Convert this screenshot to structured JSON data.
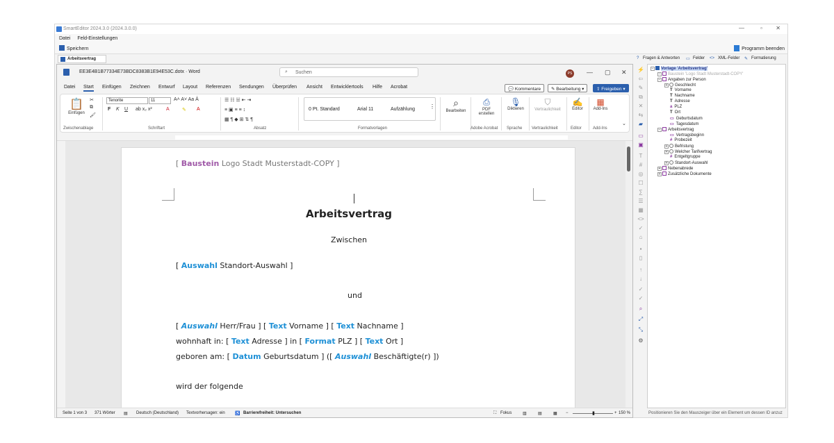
{
  "app": {
    "title": "SmartEditor 2024.3.0 (2024.3.0.0)",
    "menu": [
      "Datei",
      "Feld-Einstellungen"
    ],
    "save": "Speichern",
    "quit": "Programm beenden",
    "doc_tab": "Arbeitsvertrag"
  },
  "word": {
    "filename": "EE3E4B1B77334E73BDC8383B1E94E53C.dotx · Word",
    "search": "Suchen",
    "user_initials": "PS",
    "tabs": [
      "Datei",
      "Start",
      "Einfügen",
      "Zeichnen",
      "Entwurf",
      "Layout",
      "Referenzen",
      "Sendungen",
      "Überprüfen",
      "Ansicht",
      "Entwicklertools",
      "Hilfe",
      "Acrobat"
    ],
    "kommentare": "Kommentare",
    "bearbeitung": "Bearbeitung",
    "freigeben": "Freigeben",
    "ribbon": {
      "einfuegen": "Einfügen",
      "font": "Tenorite",
      "size": "11",
      "styles": [
        "0 Pt. Standard",
        "Arial 11",
        "Aufzählung"
      ],
      "bearbeiten": "Bearbeiten",
      "pdf": "PDF erstellen",
      "diktieren": "Diktieren",
      "vertraulichkeit": "Vertraulichkeit",
      "editor": "Editor",
      "addins": "Add-Ins",
      "groups": [
        "Zwischenablage",
        "Schriftart",
        "Absatz",
        "Formatvorlagen",
        "Adobe Acrobat",
        "Sprache",
        "Vertraulichkeit",
        "Editor",
        "Add-Ins"
      ]
    },
    "doc": {
      "l1_tag": "Baustein",
      "l1_text": "Logo Stadt Musterstadt-COPY",
      "heading": "Arbeitsvertrag",
      "zwischen": "Zwischen",
      "l2_tag": "Auswahl",
      "l2_text": "Standort-Auswahl",
      "und": "und",
      "l3a_tag": "Auswahl",
      "l3a_text": "Herr/Frau",
      "l3b_tag": "Text",
      "l3b_text": "Vorname",
      "l3c_tag": "Text",
      "l3c_text": "Nachname",
      "l4_pre": "wohnhaft in:",
      "l4a_tag": "Text",
      "l4a_text": "Adresse",
      "l4_in": "in",
      "l4b_tag": "Format",
      "l4b_text": "PLZ",
      "l4c_tag": "Text",
      "l4c_text": "Ort",
      "l5_pre": "geboren am:",
      "l5a_tag": "Datum",
      "l5a_text": "Geburtsdatum",
      "l5b_tag": "Auswahl",
      "l5b_text": "Beschäftigte(r)",
      "l6": "wird der folgende"
    },
    "status": {
      "page": "Seite 1 von 3",
      "words": "371 Wörter",
      "lang": "Deutsch (Deutschland)",
      "predict": "Textvorhersagen: ein",
      "access": "Barrierefreiheit: Untersuchen",
      "focus": "Fokus",
      "zoom": "150 %"
    }
  },
  "side": {
    "tabs": [
      "Fragen & Antworten",
      "Felder",
      "XML-Felder",
      "Formatierung"
    ],
    "tree": [
      {
        "label": "Vorlage 'Arbeitsvertrag'",
        "level": 0
      },
      {
        "label": "Baustein 'Logo Stadt Musterstadt-COPY'",
        "level": 1
      },
      {
        "label": "Angaben zur Person",
        "level": 1
      },
      {
        "label": "Geschlecht",
        "level": 2
      },
      {
        "label": "Vorname",
        "level": 2
      },
      {
        "label": "Nachname",
        "level": 2
      },
      {
        "label": "Adresse",
        "level": 2
      },
      {
        "label": "PLZ",
        "level": 2
      },
      {
        "label": "Ort",
        "level": 2
      },
      {
        "label": "Geburtsdatum",
        "level": 2
      },
      {
        "label": "Tagesdatum",
        "level": 2
      },
      {
        "label": "Arbeitsvertrag",
        "level": 1
      },
      {
        "label": "Vertragsbeginn",
        "level": 2
      },
      {
        "label": "Probezeit",
        "level": 2
      },
      {
        "label": "Befristung",
        "level": 2
      },
      {
        "label": "Welcher Tarifvertrag",
        "level": 2
      },
      {
        "label": "Entgeltgruppe",
        "level": 2
      },
      {
        "label": "Standort-Auswahl",
        "level": 2
      },
      {
        "label": "Nebenabrede",
        "level": 1
      },
      {
        "label": "Zusätzliche Dokumente",
        "level": 1
      }
    ],
    "hint": "Positionieren Sie den Mauszeiger über ein Element um dessen ID anzuz"
  }
}
